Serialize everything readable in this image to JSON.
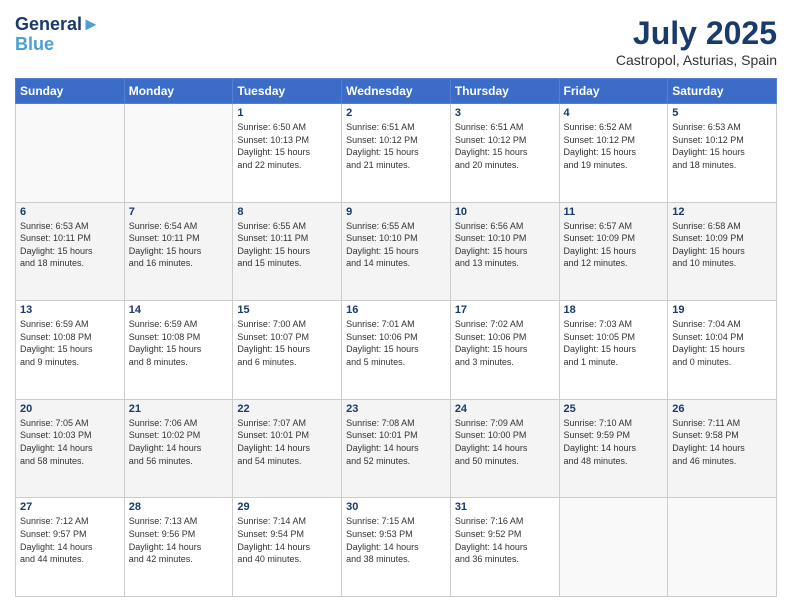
{
  "header": {
    "logo_line1": "General",
    "logo_line2": "Blue",
    "title": "July 2025",
    "subtitle": "Castropol, Asturias, Spain"
  },
  "weekdays": [
    "Sunday",
    "Monday",
    "Tuesday",
    "Wednesday",
    "Thursday",
    "Friday",
    "Saturday"
  ],
  "weeks": [
    [
      {
        "day": "",
        "info": ""
      },
      {
        "day": "",
        "info": ""
      },
      {
        "day": "1",
        "info": "Sunrise: 6:50 AM\nSunset: 10:13 PM\nDaylight: 15 hours\nand 22 minutes."
      },
      {
        "day": "2",
        "info": "Sunrise: 6:51 AM\nSunset: 10:12 PM\nDaylight: 15 hours\nand 21 minutes."
      },
      {
        "day": "3",
        "info": "Sunrise: 6:51 AM\nSunset: 10:12 PM\nDaylight: 15 hours\nand 20 minutes."
      },
      {
        "day": "4",
        "info": "Sunrise: 6:52 AM\nSunset: 10:12 PM\nDaylight: 15 hours\nand 19 minutes."
      },
      {
        "day": "5",
        "info": "Sunrise: 6:53 AM\nSunset: 10:12 PM\nDaylight: 15 hours\nand 18 minutes."
      }
    ],
    [
      {
        "day": "6",
        "info": "Sunrise: 6:53 AM\nSunset: 10:11 PM\nDaylight: 15 hours\nand 18 minutes."
      },
      {
        "day": "7",
        "info": "Sunrise: 6:54 AM\nSunset: 10:11 PM\nDaylight: 15 hours\nand 16 minutes."
      },
      {
        "day": "8",
        "info": "Sunrise: 6:55 AM\nSunset: 10:11 PM\nDaylight: 15 hours\nand 15 minutes."
      },
      {
        "day": "9",
        "info": "Sunrise: 6:55 AM\nSunset: 10:10 PM\nDaylight: 15 hours\nand 14 minutes."
      },
      {
        "day": "10",
        "info": "Sunrise: 6:56 AM\nSunset: 10:10 PM\nDaylight: 15 hours\nand 13 minutes."
      },
      {
        "day": "11",
        "info": "Sunrise: 6:57 AM\nSunset: 10:09 PM\nDaylight: 15 hours\nand 12 minutes."
      },
      {
        "day": "12",
        "info": "Sunrise: 6:58 AM\nSunset: 10:09 PM\nDaylight: 15 hours\nand 10 minutes."
      }
    ],
    [
      {
        "day": "13",
        "info": "Sunrise: 6:59 AM\nSunset: 10:08 PM\nDaylight: 15 hours\nand 9 minutes."
      },
      {
        "day": "14",
        "info": "Sunrise: 6:59 AM\nSunset: 10:08 PM\nDaylight: 15 hours\nand 8 minutes."
      },
      {
        "day": "15",
        "info": "Sunrise: 7:00 AM\nSunset: 10:07 PM\nDaylight: 15 hours\nand 6 minutes."
      },
      {
        "day": "16",
        "info": "Sunrise: 7:01 AM\nSunset: 10:06 PM\nDaylight: 15 hours\nand 5 minutes."
      },
      {
        "day": "17",
        "info": "Sunrise: 7:02 AM\nSunset: 10:06 PM\nDaylight: 15 hours\nand 3 minutes."
      },
      {
        "day": "18",
        "info": "Sunrise: 7:03 AM\nSunset: 10:05 PM\nDaylight: 15 hours\nand 1 minute."
      },
      {
        "day": "19",
        "info": "Sunrise: 7:04 AM\nSunset: 10:04 PM\nDaylight: 15 hours\nand 0 minutes."
      }
    ],
    [
      {
        "day": "20",
        "info": "Sunrise: 7:05 AM\nSunset: 10:03 PM\nDaylight: 14 hours\nand 58 minutes."
      },
      {
        "day": "21",
        "info": "Sunrise: 7:06 AM\nSunset: 10:02 PM\nDaylight: 14 hours\nand 56 minutes."
      },
      {
        "day": "22",
        "info": "Sunrise: 7:07 AM\nSunset: 10:01 PM\nDaylight: 14 hours\nand 54 minutes."
      },
      {
        "day": "23",
        "info": "Sunrise: 7:08 AM\nSunset: 10:01 PM\nDaylight: 14 hours\nand 52 minutes."
      },
      {
        "day": "24",
        "info": "Sunrise: 7:09 AM\nSunset: 10:00 PM\nDaylight: 14 hours\nand 50 minutes."
      },
      {
        "day": "25",
        "info": "Sunrise: 7:10 AM\nSunset: 9:59 PM\nDaylight: 14 hours\nand 48 minutes."
      },
      {
        "day": "26",
        "info": "Sunrise: 7:11 AM\nSunset: 9:58 PM\nDaylight: 14 hours\nand 46 minutes."
      }
    ],
    [
      {
        "day": "27",
        "info": "Sunrise: 7:12 AM\nSunset: 9:57 PM\nDaylight: 14 hours\nand 44 minutes."
      },
      {
        "day": "28",
        "info": "Sunrise: 7:13 AM\nSunset: 9:56 PM\nDaylight: 14 hours\nand 42 minutes."
      },
      {
        "day": "29",
        "info": "Sunrise: 7:14 AM\nSunset: 9:54 PM\nDaylight: 14 hours\nand 40 minutes."
      },
      {
        "day": "30",
        "info": "Sunrise: 7:15 AM\nSunset: 9:53 PM\nDaylight: 14 hours\nand 38 minutes."
      },
      {
        "day": "31",
        "info": "Sunrise: 7:16 AM\nSunset: 9:52 PM\nDaylight: 14 hours\nand 36 minutes."
      },
      {
        "day": "",
        "info": ""
      },
      {
        "day": "",
        "info": ""
      }
    ]
  ]
}
